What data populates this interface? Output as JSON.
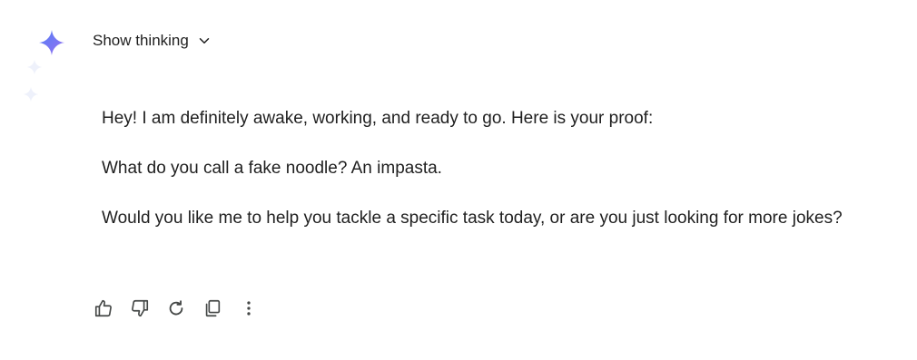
{
  "header": {
    "show_thinking_label": "Show thinking",
    "icons": {
      "assistant": "gemini-spark-icon",
      "expand": "chevron-down-icon"
    }
  },
  "response": {
    "paragraphs": [
      "Hey! I am definitely awake, working, and ready to go. Here is your proof:",
      "What do you call a fake noodle? An impasta.",
      "Would you like me to help you tackle a specific task today, or are you just looking for more jokes?"
    ]
  },
  "actions": {
    "icons": [
      "thumbs-up-icon",
      "thumbs-down-icon",
      "regenerate-icon",
      "copy-icon",
      "more-vert-icon"
    ]
  },
  "colors": {
    "text": "#1f1f1f",
    "spark_start": "#4f7df5",
    "spark_end": "#9b72f2",
    "icon": "#444746"
  }
}
